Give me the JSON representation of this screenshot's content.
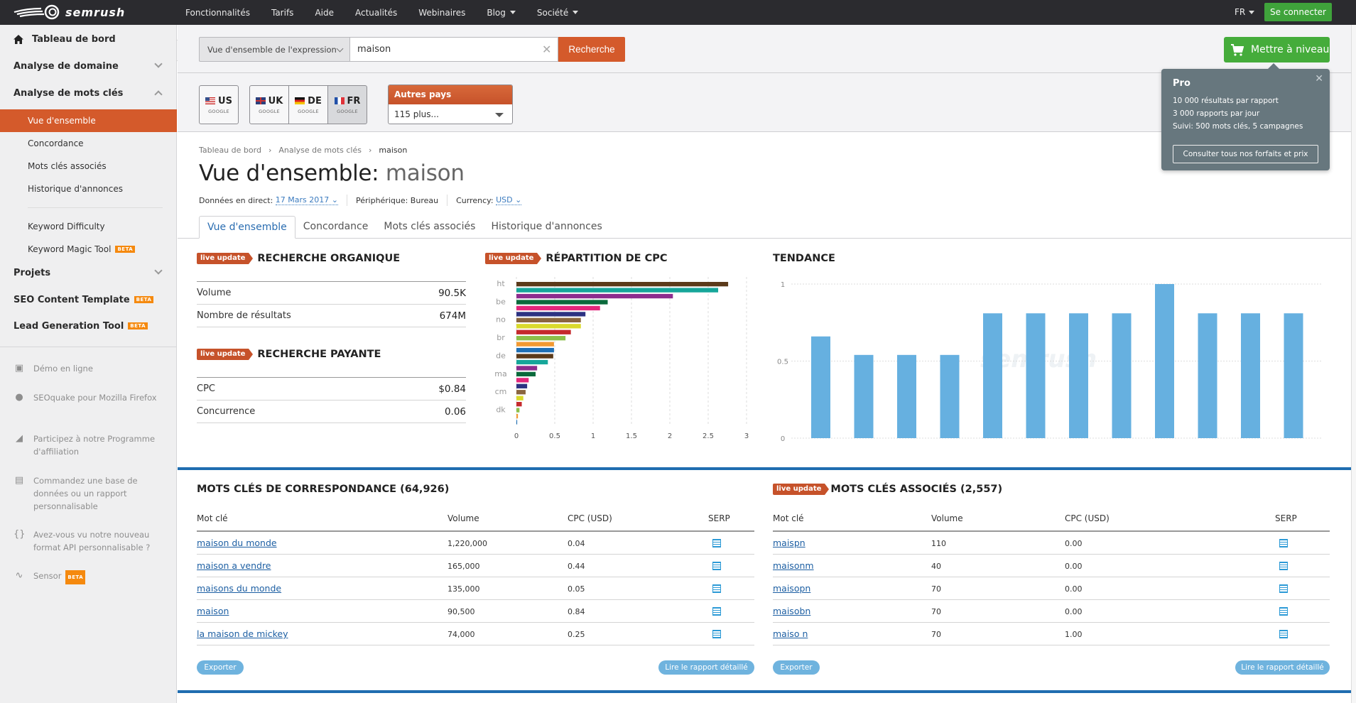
{
  "topbar": {
    "brand": "semrush",
    "nav": [
      {
        "label": "Fonctionnalités",
        "dropdown": false
      },
      {
        "label": "Tarifs",
        "dropdown": false
      },
      {
        "label": "Aide",
        "dropdown": false
      },
      {
        "label": "Actualités",
        "dropdown": false
      },
      {
        "label": "Webinaires",
        "dropdown": false
      },
      {
        "label": "Blog",
        "dropdown": true
      },
      {
        "label": "Société",
        "dropdown": true
      }
    ],
    "language": "FR",
    "login_label": "Se connecter"
  },
  "sidebar": {
    "dashboard": "Tableau de bord",
    "domain_analysis": "Analyse de domaine",
    "keyword_analysis": "Analyse de mots clés",
    "sub_items": [
      "Vue d'ensemble",
      "Concordance",
      "Mots clés associés",
      "Historique d'annonces"
    ],
    "tools": [
      "Keyword Difficulty",
      "Keyword Magic Tool"
    ],
    "projects": "Projets",
    "seo_template": "SEO Content Template",
    "lead_gen": "Lead Generation Tool",
    "beta": "BETA",
    "promos": [
      {
        "icon": "demo-icon",
        "text": "Démo en ligne"
      },
      {
        "icon": "seoquake-icon",
        "text": "SEOquake pour Mozilla Firefox"
      },
      {
        "icon": "megaphone-icon",
        "text": "Participez à notre Programme d'affiliation"
      },
      {
        "icon": "clipboard-icon",
        "text": "Commandez une base de données ou un rapport personnalisable"
      },
      {
        "icon": "braces-icon",
        "text": "Avez-vous vu notre nouveau format API personnalisable ?"
      },
      {
        "icon": "pulse-icon",
        "text": "Sensor"
      }
    ]
  },
  "search": {
    "type": "Vue d'ensemble de l'expression",
    "value": "maison",
    "button": "Recherche"
  },
  "databases": [
    {
      "code": "US",
      "engine": "GOOGLE",
      "selected": false
    },
    {
      "code": "UK",
      "engine": "GOOGLE",
      "selected": false
    },
    {
      "code": "DE",
      "engine": "GOOGLE",
      "selected": false
    },
    {
      "code": "FR",
      "engine": "GOOGLE",
      "selected": true
    }
  ],
  "other_countries": {
    "header": "Autres pays",
    "value": "115 plus..."
  },
  "upgrade": {
    "label": "Mettre à niveau"
  },
  "pro_popup": {
    "title": "Pro",
    "lines": [
      "10 000 résultats par rapport",
      "3 000 rapports par jour",
      "Suivi: 500 mots clés, 5 campagnes"
    ],
    "button": "Consulter tous nos forfaits et prix"
  },
  "breadcrumb": [
    "Tableau de bord",
    "Analyse de mots clés",
    "maison"
  ],
  "page": {
    "title_prefix": "Vue d'ensemble:",
    "keyword": "maison",
    "live_data_label": "Données en direct:",
    "live_data_date": "17 Mars 2017",
    "device": "Périphérique: Bureau",
    "currency_label": "Currency:",
    "currency": "USD"
  },
  "tabs": [
    {
      "label": "Vue d'ensemble",
      "active": true
    },
    {
      "label": "Concordance",
      "active": false
    },
    {
      "label": "Mots clés associés",
      "active": false
    },
    {
      "label": "Historique d'annonces",
      "active": false
    }
  ],
  "live_badge": "live update",
  "organic": {
    "title": "RECHERCHE ORGANIQUE",
    "rows": [
      {
        "label": "Volume",
        "value": "90.5K"
      },
      {
        "label": "Nombre de résultats",
        "value": "674M"
      }
    ]
  },
  "paid": {
    "title": "RECHERCHE PAYANTE",
    "rows": [
      {
        "label": "CPC",
        "value": "$0.84"
      },
      {
        "label": "Concurrence",
        "value": "0.06"
      }
    ]
  },
  "chart_data": [
    {
      "type": "bar",
      "orientation": "horizontal",
      "title": "RÉPARTITION DE CPC",
      "categories": [
        "ht",
        "",
        "",
        "be",
        "",
        "",
        "no",
        "",
        "",
        "br",
        "",
        "",
        "de",
        "",
        "",
        "ma",
        "",
        "",
        "cm",
        "",
        "",
        "dk",
        "",
        ""
      ],
      "values": [
        2.76,
        2.63,
        2.04,
        1.19,
        1.09,
        0.9,
        0.84,
        0.84,
        0.71,
        0.64,
        0.49,
        0.49,
        0.48,
        0.41,
        0.27,
        0.25,
        0.16,
        0.14,
        0.12,
        0.09,
        0.07,
        0.04,
        0.02,
        0.01
      ],
      "colors": [
        "#5b3a1a",
        "#16a69a",
        "#8d2d8e",
        "#0b6a3c",
        "#e3277b",
        "#2d3282",
        "#8a6540",
        "#d9d92c",
        "#c52a2d",
        "#8cc04a",
        "#f29a32",
        "#1f6fb5",
        "#5b3a1a",
        "#16a69a",
        "#8d2d8e",
        "#0b6a3c",
        "#e3277b",
        "#2d3282",
        "#8a6540",
        "#d9d92c",
        "#c52a2d",
        "#8cc04a",
        "#f29a32",
        "#1f6fb5"
      ],
      "xticks": [
        "0",
        "0.5",
        "1",
        "1.5",
        "2",
        "2.5",
        "3"
      ],
      "xlim": [
        0,
        3
      ],
      "grid": true
    },
    {
      "type": "bar",
      "title": "TENDANCE",
      "values": [
        0.66,
        0.54,
        0.54,
        0.54,
        0.81,
        0.81,
        0.81,
        0.81,
        1.0,
        0.81,
        0.81,
        0.81
      ],
      "yticks": [
        "0",
        "0.5",
        "1"
      ],
      "ylim": [
        0,
        1
      ],
      "color": "#66b0e0",
      "grid": true
    }
  ],
  "matching": {
    "title": "MOTS CLÉS DE CORRESPONDANCE (64,926)",
    "columns": [
      "Mot clé",
      "Volume",
      "CPC (USD)",
      "SERP"
    ],
    "rows": [
      [
        "maison du monde",
        "1,220,000",
        "0.04"
      ],
      [
        "maison a vendre",
        "165,000",
        "0.44"
      ],
      [
        "maisons du monde",
        "135,000",
        "0.05"
      ],
      [
        "maison",
        "90,500",
        "0.84"
      ],
      [
        "la maison de mickey",
        "74,000",
        "0.25"
      ]
    ],
    "export": "Exporter",
    "report": "Lire le rapport détaillé"
  },
  "related": {
    "title": "MOTS CLÉS ASSOCIÉS (2,557)",
    "columns": [
      "Mot clé",
      "Volume",
      "CPC (USD)",
      "SERP"
    ],
    "rows": [
      [
        "maispn",
        "110",
        "0.00"
      ],
      [
        "maisonm",
        "40",
        "0.00"
      ],
      [
        "maisopn",
        "70",
        "0.00"
      ],
      [
        "maisobn",
        "70",
        "0.00"
      ],
      [
        "maiso n",
        "70",
        "1.00"
      ]
    ],
    "export": "Exporter",
    "report": "Lire le rapport détaillé"
  }
}
